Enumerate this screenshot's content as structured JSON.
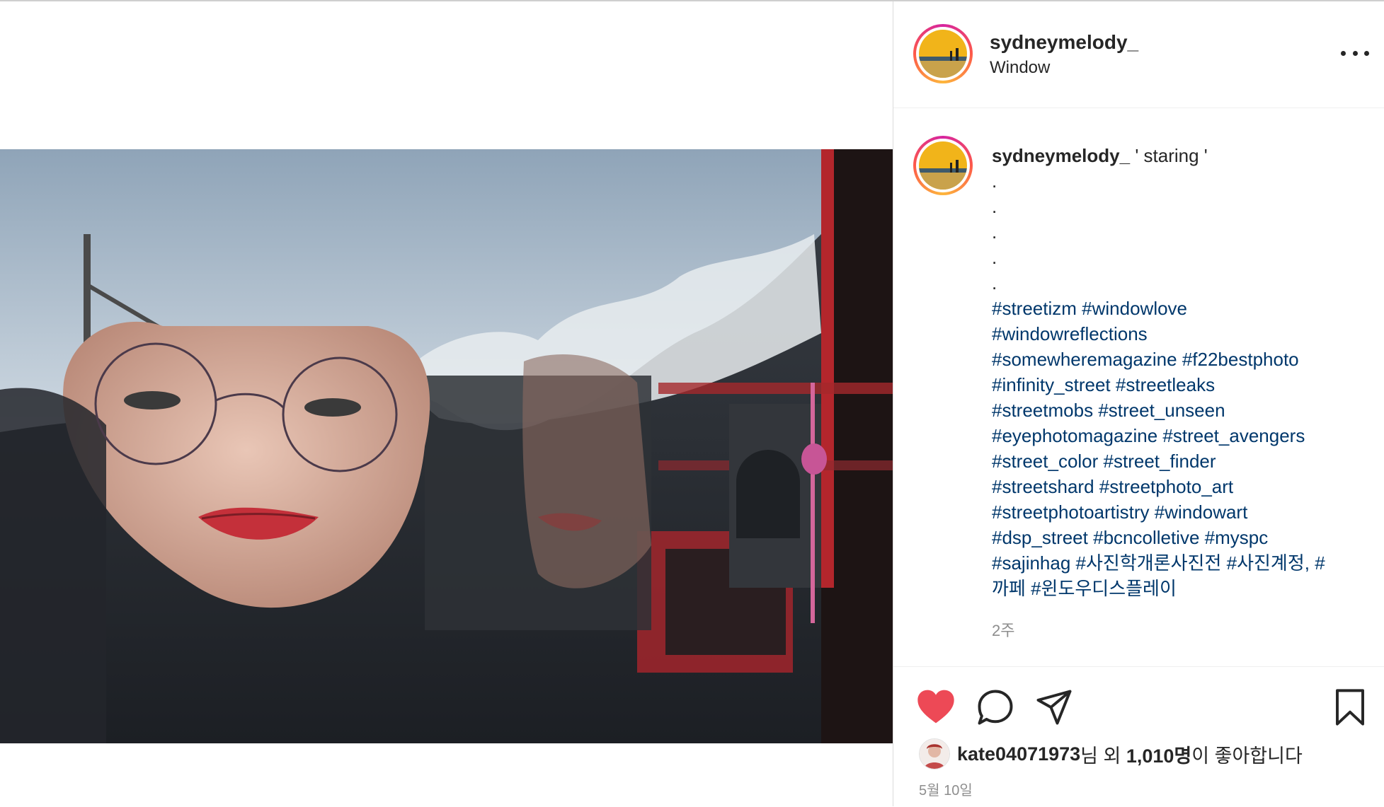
{
  "post": {
    "username": "sydneymelody_",
    "location": "Window",
    "caption_text": "' staring '",
    "caption_dots": [
      ".",
      ".",
      ".",
      ".",
      "."
    ],
    "hashtag_lines": [
      [
        "#streetizm",
        "#windowlove"
      ],
      [
        "#windowreflections"
      ],
      [
        "#somewheremagazine",
        "#f22bestphoto"
      ],
      [
        "#infinity_street",
        "#streetleaks"
      ],
      [
        "#streetmobs",
        "#street_unseen"
      ],
      [
        "#eyephotomagazine",
        "#street_avengers"
      ],
      [
        "#street_color",
        "#street_finder"
      ],
      [
        "#streetshard",
        "#streetphoto_art"
      ],
      [
        "#streetphotoartistry",
        "#windowart"
      ],
      [
        "#dsp_street",
        "#bcncolletive",
        "#myspc"
      ],
      [
        "#sajinhag",
        "#사진학개론사진전",
        "#사진계정, #"
      ],
      [
        "까페",
        "#윈도우디스플레이"
      ]
    ],
    "caption_time": "2주",
    "liked_by": "kate04071973",
    "likes_mid": "님 외 ",
    "likes_count": "1,010명",
    "likes_suffix": "이 좋아합니다",
    "date": "5월 10일"
  },
  "icons": {
    "more": "more-options-icon",
    "like": "heart-icon",
    "comment": "comment-icon",
    "share": "share-icon",
    "save": "bookmark-icon"
  },
  "colors": {
    "heart": "#ed4956",
    "hashtag": "#00376b",
    "secondary_text": "#8e8e8e"
  }
}
